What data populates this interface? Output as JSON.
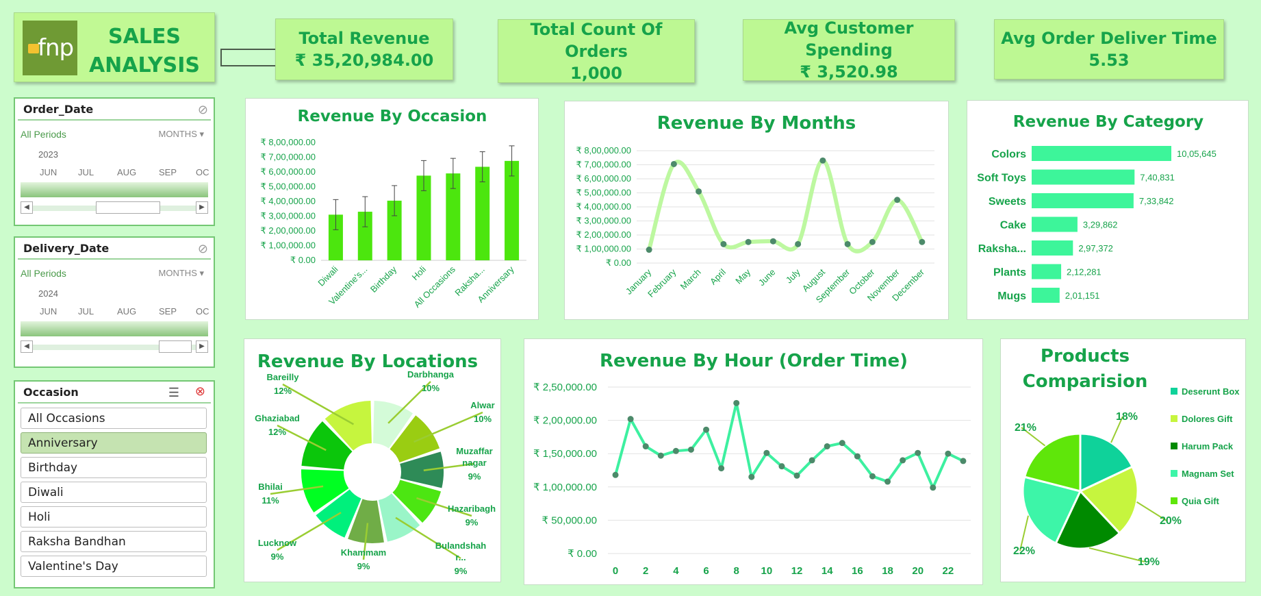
{
  "header": {
    "logo_text": "fnp",
    "title_line1": "SALES",
    "title_line2": "ANALYSIS"
  },
  "kpis": [
    {
      "title": "Total Revenue",
      "value": "₹ 35,20,984.00"
    },
    {
      "title": "Total Count Of Orders",
      "value": "1,000"
    },
    {
      "title": "Avg Customer Spending",
      "value": "₹ 3,520.98"
    },
    {
      "title": "Avg Order Deliver Time",
      "value": "5.53"
    }
  ],
  "order_timeline": {
    "title": "Order_Date",
    "periods": "All Periods",
    "level": "MONTHS ▾",
    "year": "2023",
    "months": [
      "JUN",
      "JUL",
      "AUG",
      "SEP",
      "OC"
    ]
  },
  "delivery_timeline": {
    "title": "Delivery_Date",
    "periods": "All Periods",
    "level": "MONTHS ▾",
    "year": "2024",
    "months": [
      "JUN",
      "JUL",
      "AUG",
      "SEP",
      "OC"
    ]
  },
  "occasion_slicer": {
    "title": "Occasion",
    "items": [
      "All Occasions",
      "Anniversary",
      "Birthday",
      "Diwali",
      "Holi",
      "Raksha Bandhan",
      "Valentine's Day"
    ],
    "selected": "Anniversary"
  },
  "colors": {
    "accent": "#16a34a",
    "kpi_bg": "#bdf893",
    "page_bg": "#ccfccc",
    "bar": "#4ce60e",
    "line_months": "#bdf8a0",
    "line_hour": "#3df0a0",
    "category_bar": "#3df59a"
  },
  "chart_data": [
    {
      "id": "occasion",
      "type": "bar",
      "title": "Revenue By Occasion",
      "categories": [
        "Diwali",
        "Valentine's...",
        "Birthday",
        "Holi",
        "All Occasions",
        "Raksha...",
        "Anniversary"
      ],
      "values": [
        310000,
        330000,
        405000,
        575000,
        590000,
        635000,
        675000
      ],
      "error_bars": true,
      "ylim": [
        0,
        800000
      ],
      "yticks": [
        "₹ 0.00",
        "₹ 1,00,000.00",
        "₹ 2,00,000.00",
        "₹ 3,00,000.00",
        "₹ 4,00,000.00",
        "₹ 5,00,000.00",
        "₹ 6,00,000.00",
        "₹ 7,00,000.00",
        "₹ 8,00,000.00"
      ]
    },
    {
      "id": "months",
      "type": "line",
      "title": "Revenue By Months",
      "categories": [
        "January",
        "February",
        "March",
        "April",
        "May",
        "June",
        "July",
        "August",
        "September",
        "October",
        "November",
        "December"
      ],
      "values": [
        95000,
        705000,
        510000,
        135000,
        150000,
        155000,
        135000,
        730000,
        135000,
        150000,
        450000,
        150000
      ],
      "ylim": [
        0,
        800000
      ],
      "yticks": [
        "₹ 0.00",
        "₹ 1,00,000.00",
        "₹ 2,00,000.00",
        "₹ 3,00,000.00",
        "₹ 4,00,000.00",
        "₹ 5,00,000.00",
        "₹ 6,00,000.00",
        "₹ 7,00,000.00",
        "₹ 8,00,000.00"
      ]
    },
    {
      "id": "category",
      "type": "bar",
      "orientation": "horizontal",
      "title": "Revenue By Category",
      "categories": [
        "Colors",
        "Soft Toys",
        "Sweets",
        "Cake",
        "Raksha...",
        "Plants",
        "Mugs"
      ],
      "values": [
        1005645,
        740831,
        733842,
        329862,
        297372,
        212281,
        201151
      ],
      "labels": [
        "10,05,645",
        "7,40,831",
        "7,33,842",
        "3,29,862",
        "2,97,372",
        "2,12,281",
        "2,01,151"
      ]
    },
    {
      "id": "locations",
      "type": "pie",
      "donut": true,
      "title": "Revenue By Locations",
      "labels": [
        "Darbhanga",
        "Alwar",
        "Muzaffar nagar",
        "Hazaribagh",
        "Bulandshahr...",
        "Khammam",
        "Lucknow",
        "Bhilai",
        "Ghaziabad",
        "Bareilly"
      ],
      "label_lines": [
        [
          "Darbhanga"
        ],
        [
          "Alwar"
        ],
        [
          "Muzaffar",
          "nagar"
        ],
        [
          "Hazaribagh"
        ],
        [
          "Bulandshah",
          "r..."
        ],
        [
          "Khammam"
        ],
        [
          "Lucknow"
        ],
        [
          "Bhilai"
        ],
        [
          "Ghaziabad"
        ],
        [
          "Bareilly"
        ]
      ],
      "values": [
        10,
        10,
        9,
        9,
        9,
        9,
        9,
        11,
        12,
        12
      ],
      "percent_labels": [
        "10%",
        "10%",
        "9%",
        "9%",
        "9%",
        "9%",
        "9%",
        "11%",
        "12%",
        "12%"
      ],
      "colors": [
        "#d4fbd8",
        "#9acd12",
        "#2e8b57",
        "#4ce612",
        "#9af5c8",
        "#70ad47",
        "#00f07c",
        "#00ff22",
        "#0bc60b",
        "#c6f53e"
      ]
    },
    {
      "id": "hour",
      "type": "line",
      "title": "Revenue By Hour (Order Time)",
      "x": [
        0,
        1,
        2,
        3,
        4,
        5,
        6,
        7,
        8,
        9,
        10,
        11,
        12,
        13,
        14,
        15,
        16,
        17,
        18,
        19,
        20,
        21,
        22,
        23
      ],
      "values": [
        118000,
        202000,
        161000,
        147000,
        154000,
        156000,
        186000,
        128000,
        226000,
        115000,
        151000,
        131000,
        117000,
        140000,
        161000,
        166000,
        146000,
        116000,
        108000,
        140000,
        151000,
        99000,
        150000,
        139000
      ],
      "xticks": [
        "0",
        "2",
        "4",
        "6",
        "8",
        "10",
        "12",
        "14",
        "16",
        "18",
        "20",
        "22"
      ],
      "ylim": [
        0,
        250000
      ],
      "yticks": [
        "₹ 0.00",
        "₹ 50,000.00",
        "₹ 1,00,000.00",
        "₹ 1,50,000.00",
        "₹ 2,00,000.00",
        "₹ 2,50,000.00"
      ]
    },
    {
      "id": "products",
      "type": "pie",
      "title": "Products Comparision",
      "title_lines": [
        "Products",
        "Comparision"
      ],
      "labels": [
        "Deserunt Box",
        "Dolores Gift",
        "Harum Pack",
        "Magnam Set",
        "Quia Gift"
      ],
      "values": [
        18,
        20,
        19,
        22,
        21
      ],
      "percent_labels": [
        "18%",
        "20%",
        "19%",
        "22%",
        "21%"
      ],
      "colors": [
        "#0fd29a",
        "#c6f53e",
        "#008a00",
        "#3df5a8",
        "#5fe60a"
      ],
      "legend": "right"
    }
  ]
}
